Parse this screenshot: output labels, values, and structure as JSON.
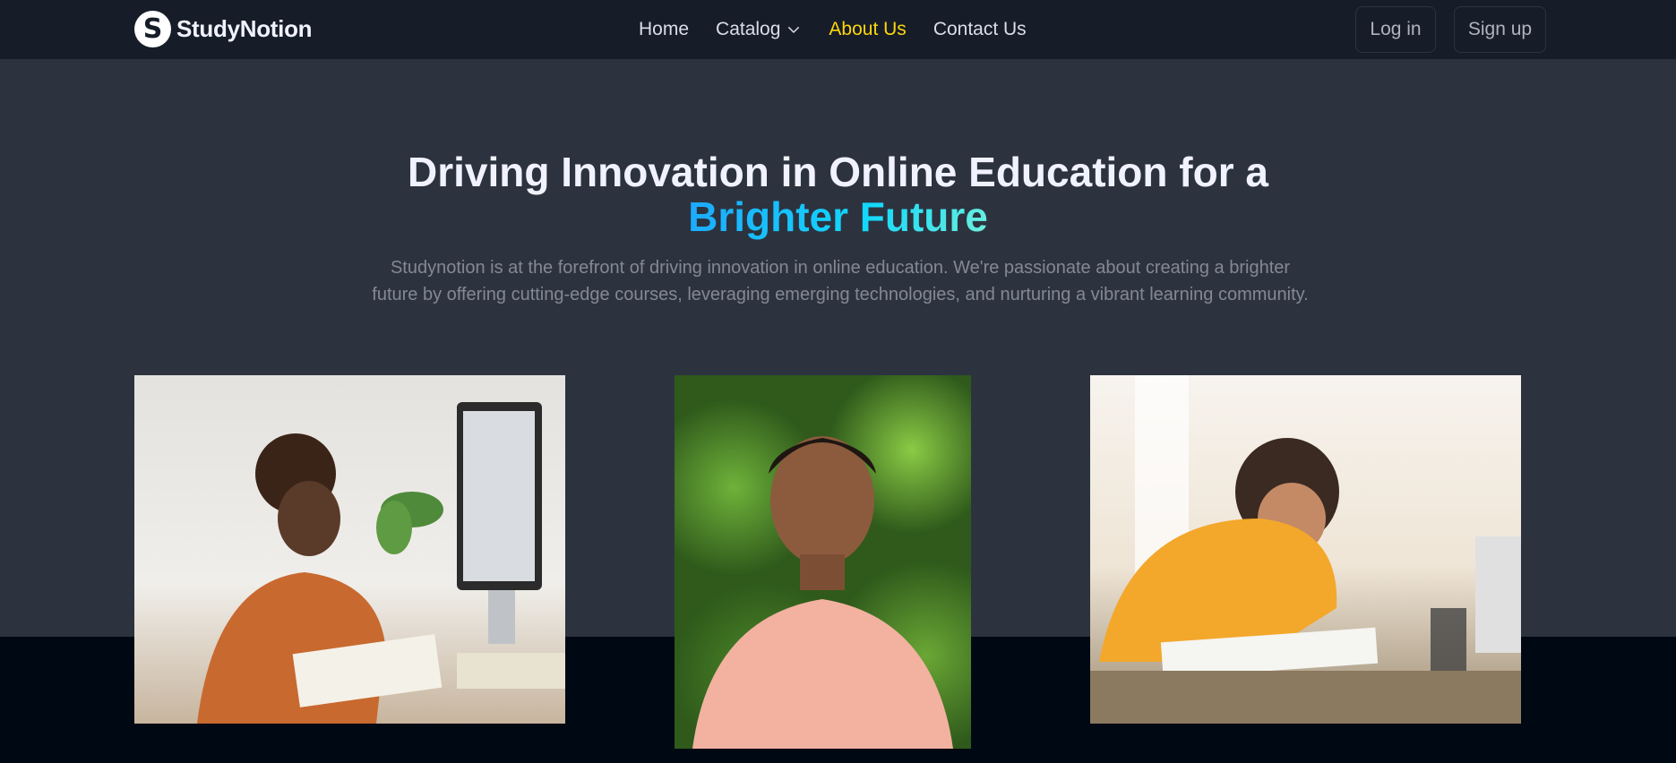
{
  "brand": {
    "name": "StudyNotion",
    "logo_letter": "S"
  },
  "nav": {
    "links": [
      {
        "label": "Home"
      },
      {
        "label": "Catalog"
      },
      {
        "label": "About Us",
        "active": true
      },
      {
        "label": "Contact Us"
      }
    ]
  },
  "auth": {
    "login_label": "Log in",
    "signup_label": "Sign up"
  },
  "hero": {
    "heading_prefix": "Driving Innovation in Online Education for a",
    "heading_highlight": "Brighter Future",
    "description": "Studynotion is at the forefront of driving innovation in online education. We're passionate about creating a brighter future by offering cutting-edge courses, leveraging emerging technologies, and nurturing a vibrant learning community."
  },
  "colors": {
    "nav_bg": "#161D29",
    "hero_bg": "#2C333F",
    "page_bg": "#000814",
    "active_link": "#FFD60A",
    "text": "#F1F2FF",
    "muted": "#838894"
  },
  "icons": {
    "catalog_dropdown": "chevron-down-icon"
  }
}
